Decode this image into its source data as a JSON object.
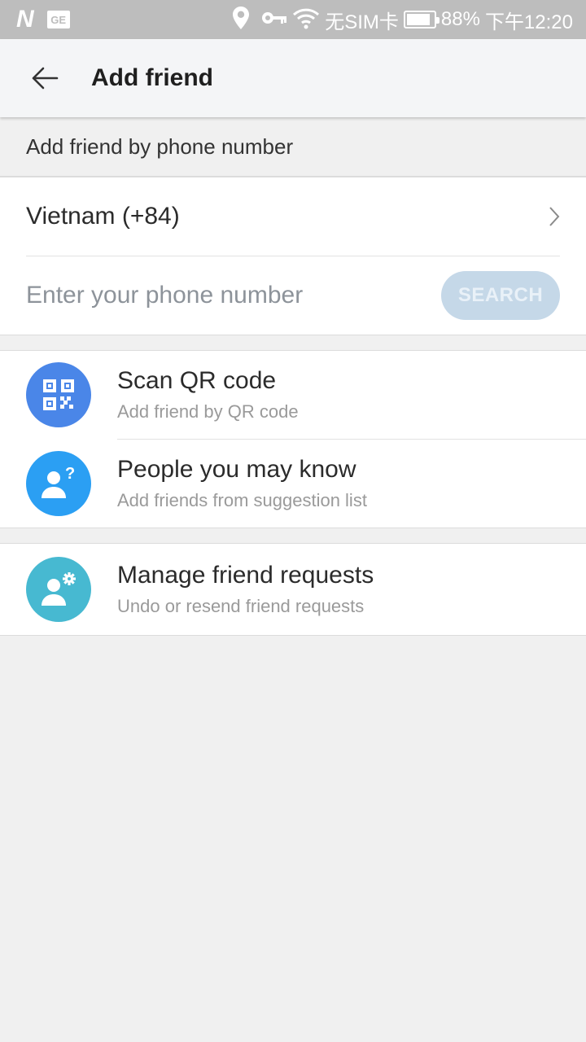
{
  "status_bar": {
    "sim_text": "无SIM卡",
    "battery": "88%",
    "time": "下午12:20",
    "battery_level": 0.88,
    "icons": [
      "n-icon",
      "ge-icon",
      "location-icon",
      "key-icon",
      "wifi-icon",
      "battery-icon"
    ]
  },
  "header": {
    "title": "Add friend",
    "back_icon": "arrow-left-icon"
  },
  "phone_section": {
    "label": "Add friend by phone number",
    "country": "Vietnam (+84)",
    "placeholder": "Enter your phone number",
    "value": "",
    "search_label": "SEARCH"
  },
  "options": [
    {
      "title": "Scan QR code",
      "subtitle": "Add friend by QR code",
      "icon": "qr-code-icon",
      "color": "#4a86e8"
    },
    {
      "title": "People you may know",
      "subtitle": "Add friends from suggestion list",
      "icon": "person-question-icon",
      "color": "#2b9ff3"
    }
  ],
  "manage": {
    "title": "Manage friend requests",
    "subtitle": "Undo or resend friend requests",
    "icon": "person-gear-icon",
    "color": "#47b9d1"
  }
}
